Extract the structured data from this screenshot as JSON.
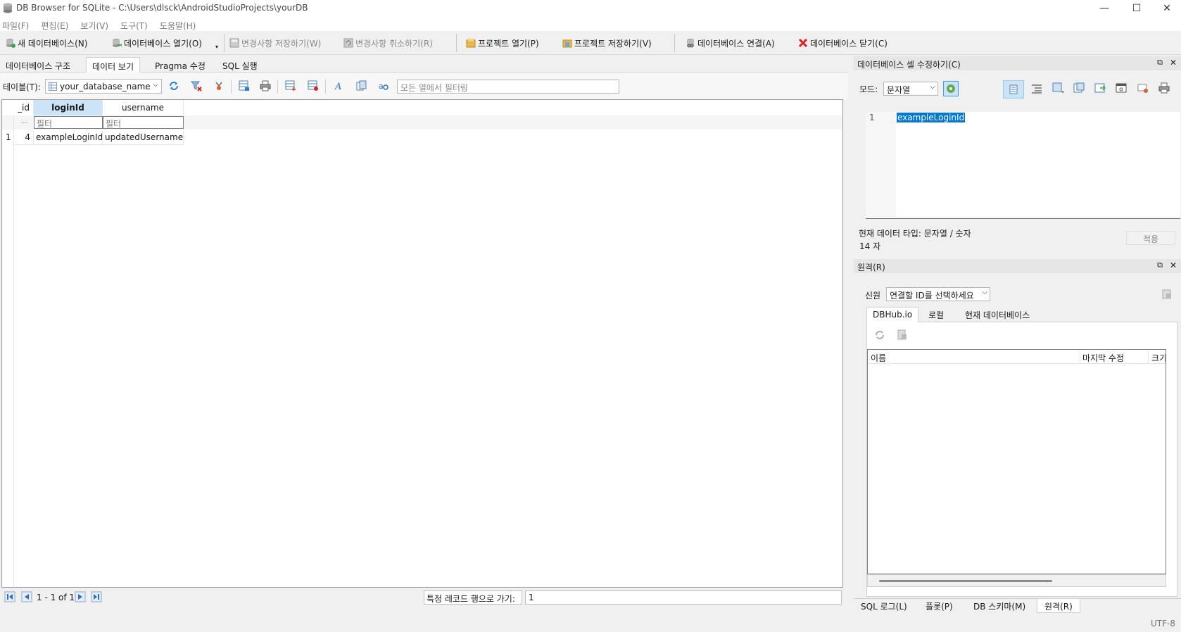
{
  "window": {
    "title": "DB Browser for SQLite - C:\\Users\\dlsck\\AndroidStudioProjects\\yourDB",
    "minimize": "—",
    "maximize": "☐",
    "close": "✕"
  },
  "menu": [
    "파일(F)",
    "편집(E)",
    "보기(V)",
    "도구(T)",
    "도움말(H)"
  ],
  "toolbar": {
    "new_db": "새 데이터베이스(N)",
    "open_db": "데이터베이스 열기(O)",
    "save_changes": "변경사항 저장하기(W)",
    "revert_changes": "변경사항 취소하기(R)",
    "open_project": "프로젝트 열기(P)",
    "save_project": "프로젝트 저장하기(V)",
    "attach_db": "데이터베이스 연결(A)",
    "close_db": "데이터베이스 닫기(C)"
  },
  "tabs": [
    "데이터베이스 구조",
    "데이터 보기",
    "Pragma 수정",
    "SQL 실행"
  ],
  "browse": {
    "table_label": "테이블(T):",
    "table_value": "your_database_name",
    "filter_placeholder": "모든 열에서 필터링"
  },
  "grid": {
    "columns": [
      "_id",
      "loginId",
      "username"
    ],
    "filter_row_marker": "...",
    "filter_placeholder": "필터",
    "rows": [
      {
        "row_num": "1",
        "id": "4",
        "loginId": "exampleLoginId",
        "username": "updatedUsername"
      }
    ]
  },
  "navigation": {
    "record_info": "1 - 1 of 1",
    "goto_label": "특정 레코드 행으로 가기:",
    "goto_value": "1"
  },
  "edit_cell": {
    "title": "데이터베이스 셀 수정하기(C)",
    "mode_label": "모드:",
    "mode_value": "문자열",
    "line_number": "1",
    "text": "exampleLoginId",
    "type_info": "현재 데이터 타입: 문자열 / 숫자",
    "size_info": "14 자",
    "apply": "적용"
  },
  "remote": {
    "title": "원격(R)",
    "identity_label": "신원",
    "identity_value": "연결할 ID를 선택하세요",
    "tabs": [
      "DBHub.io",
      "로컬",
      "현재 데이터베이스"
    ],
    "columns": [
      "이름",
      "마지막 수정",
      "크기"
    ]
  },
  "bottom_tabs": [
    "SQL 로그(L)",
    "플롯(P)",
    "DB 스키마(M)",
    "원격(R)"
  ],
  "status": {
    "encoding": "UTF-8"
  },
  "colors": {
    "accent": "#3399ff",
    "header_selected": "#cce4f7",
    "selection": "#0078d7"
  }
}
